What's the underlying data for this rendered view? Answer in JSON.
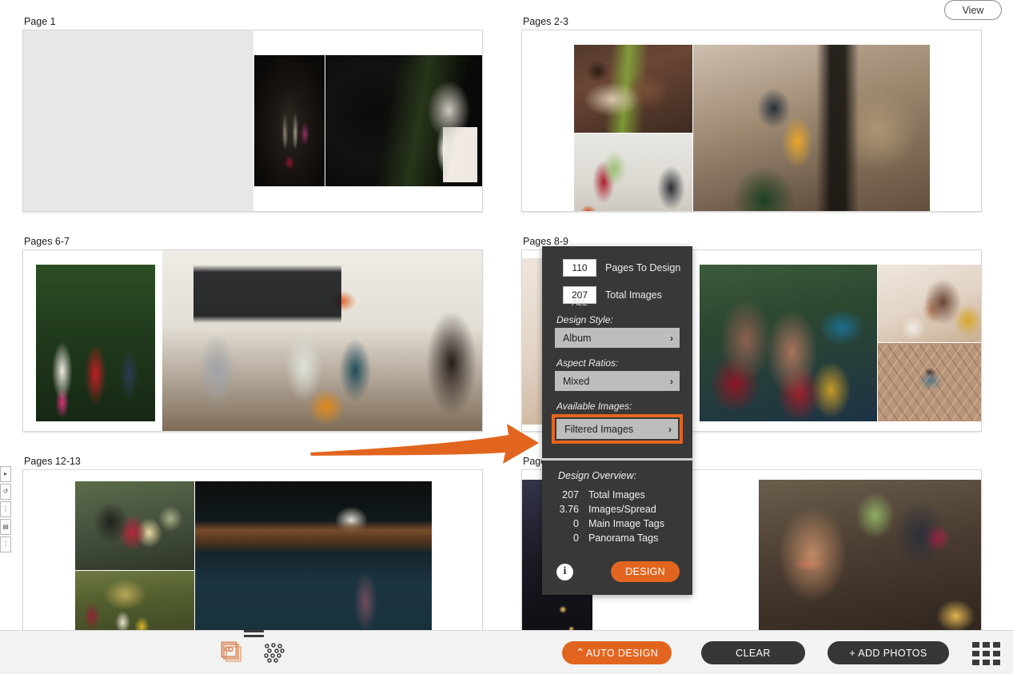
{
  "header": {
    "view_button": "View"
  },
  "spreads": [
    {
      "label": "Page 1"
    },
    {
      "label": "Pages 2-3"
    },
    {
      "label": "Pages 6-7"
    },
    {
      "label": "Pages 8-9"
    },
    {
      "label": "Pages 12-13"
    },
    {
      "label": "Pages"
    }
  ],
  "dialog": {
    "pages_to_design_value": "110",
    "pages_to_design_label": "Pages To Design",
    "total_images_value": "207",
    "total_images_label": "Total Images",
    "all_note": "ALL",
    "design_style_label": "Design Style:",
    "design_style_value": "Album",
    "aspect_ratios_label": "Aspect Ratios:",
    "aspect_ratios_value": "Mixed",
    "available_images_label": "Available Images:",
    "available_images_value": "Filtered Images",
    "chevron": "›",
    "overview_title": "Design Overview:",
    "overview_rows": [
      {
        "value": "207",
        "name": "Total Images"
      },
      {
        "value": "3.76",
        "name": "Images/Spread"
      },
      {
        "value": "0",
        "name": "Main Image Tags"
      },
      {
        "value": "0",
        "name": "Panorama Tags"
      }
    ],
    "info_icon_label": "i",
    "design_button": "DESIGN",
    "highlight_color": "#e2651f",
    "panel_color": "#383838"
  },
  "toolbar": {
    "auto_design": "AUTO DESIGN",
    "auto_design_prefix": "⌃",
    "clear": "CLEAR",
    "add_photos": "+ ADD PHOTOS",
    "accent_color": "#e2651f",
    "dark_color": "#363636"
  },
  "left_rail": {
    "items": [
      {
        "icon": "arrow-right-icon",
        "glyph": "▸"
      },
      {
        "icon": "rotate-icon",
        "glyph": "↺"
      },
      {
        "icon": "vertical-align-icon",
        "glyph": "⋮"
      },
      {
        "icon": "split-layout-icon",
        "glyph": "▤"
      },
      {
        "icon": "more-options-icon",
        "glyph": "⋮"
      }
    ]
  }
}
